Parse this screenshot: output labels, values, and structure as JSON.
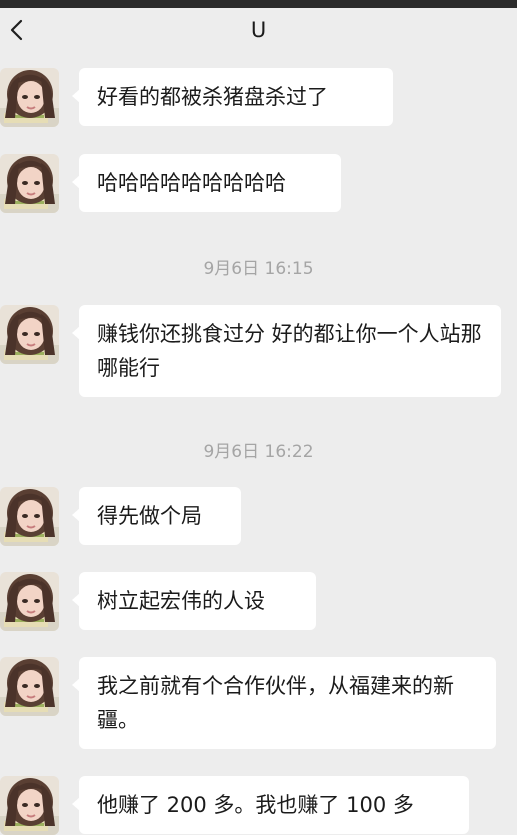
{
  "header": {
    "title": "U",
    "back_icon": "chevron-left-icon"
  },
  "messages": [
    {
      "text": "好看的都被杀猪盘杀过了"
    },
    {
      "text": "哈哈哈哈哈哈哈哈哈"
    },
    {
      "text": "赚钱你还挑食过分 好的都让你一个人站那哪能行"
    },
    {
      "text": "得先做个局"
    },
    {
      "text": "树立起宏伟的人设"
    },
    {
      "text": "我之前就有个合作伙伴，从福建来的新疆。"
    },
    {
      "text": "他赚了 200 多。我也赚了 100 多"
    }
  ],
  "timestamps": [
    {
      "text": "9月6日 16:15"
    },
    {
      "text": "9月6日 16:22"
    }
  ],
  "colors": {
    "background": "#ededed",
    "bubble": "#ffffff",
    "text": "#1b1b1b",
    "timestamp": "#a5a5a5"
  }
}
